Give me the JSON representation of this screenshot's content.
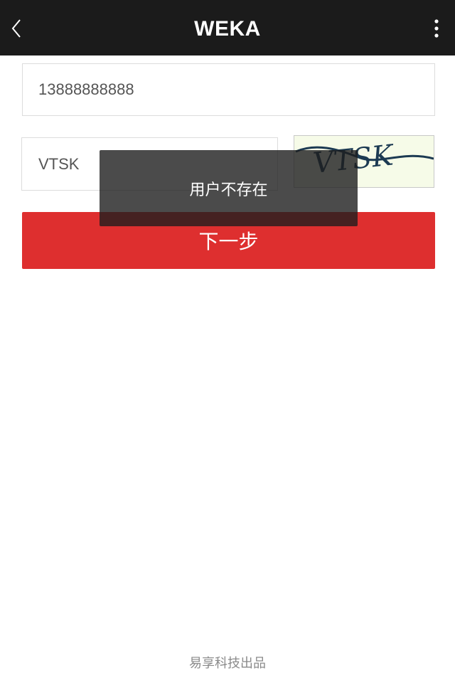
{
  "header": {
    "title": "WEKA",
    "back_icon": "chevron-left-icon",
    "more_icon": "more-vertical-icon",
    "background": "#1b1b1b"
  },
  "form": {
    "phone_value": "13888888888",
    "captcha_value": "VTSK",
    "captcha_image_text": "VTSK",
    "next_label": "下一步",
    "button_color": "#de2f2f"
  },
  "toast": {
    "message": "用户不存在"
  },
  "footer": {
    "text": "易享科技出品"
  }
}
